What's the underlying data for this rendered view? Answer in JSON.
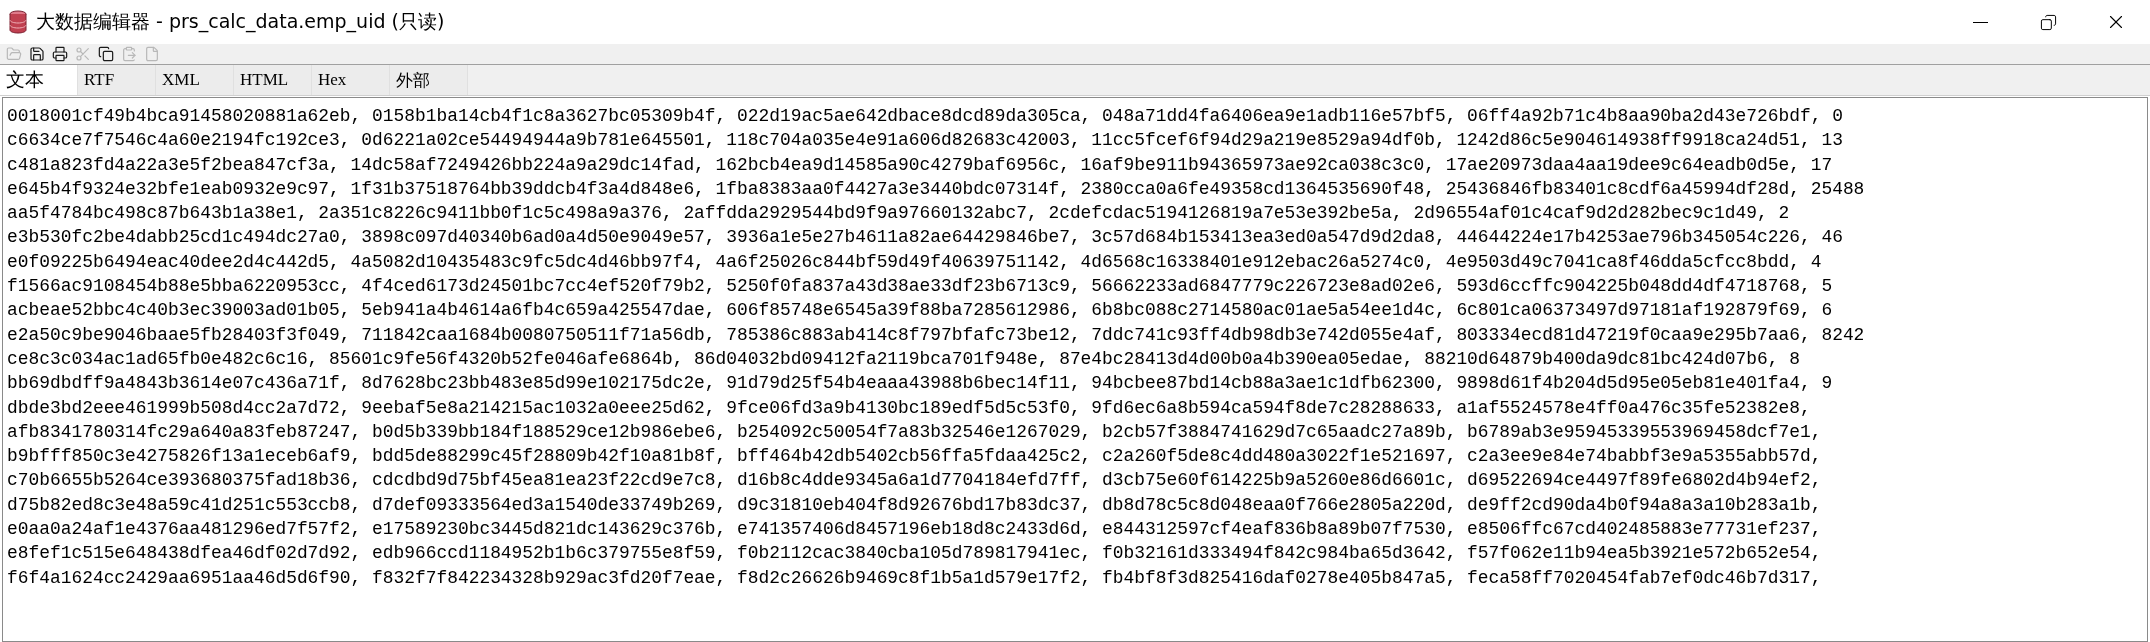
{
  "window": {
    "title": "大数据编辑器 - prs_calc_data.emp_uid (只读)"
  },
  "toolbar": [
    {
      "kind": "open",
      "disabled": true
    },
    {
      "kind": "save",
      "disabled": false
    },
    {
      "kind": "print",
      "disabled": false
    },
    {
      "kind": "cut",
      "disabled": true
    },
    {
      "kind": "copy",
      "disabled": false
    },
    {
      "kind": "paste",
      "disabled": true
    },
    {
      "kind": "page",
      "disabled": true
    }
  ],
  "tabs": [
    {
      "label": "文本",
      "selected": true
    },
    {
      "label": "RTF",
      "selected": false
    },
    {
      "label": "XML",
      "selected": false
    },
    {
      "label": "HTML",
      "selected": false
    },
    {
      "label": "Hex",
      "selected": false
    },
    {
      "label": "外部",
      "selected": false
    }
  ],
  "text_lines": [
    "0018001cf49b4bca91458020881a62eb, 0158b1ba14cb4f1c8a3627bc05309b4f, 022d19ac5ae642dbace8dcd89da305ca, 048a71dd4fa6406ea9e1adb116e57bf5, 06ff4a92b71c4b8aa90ba2d43e726bdf, 0",
    "c6634ce7f7546c4a60e2194fc192ce3, 0d6221a02ce54494944a9b781e645501, 118c704a035e4e91a606d82683c42003, 11cc5fcef6f94d29a219e8529a94df0b, 1242d86c5e904614938ff9918ca24d51, 13",
    "c481a823fd4a22a3e5f2bea847cf3a, 14dc58af7249426bb224a9a29dc14fad, 162bcb4ea9d14585a90c4279baf6956c, 16af9be911b94365973ae92ca038c3c0, 17ae20973daa4aa19dee9c64eadb0d5e, 17",
    "e645b4f9324e32bfe1eab0932e9c97, 1f31b37518764bb39ddcb4f3a4d848e6, 1fba8383aa0f4427a3e3440bdc07314f, 2380cca0a6fe49358cd1364535690f48, 25436846fb83401c8cdf6a45994df28d, 25488",
    "aa5f4784bc498c87b643b1a38e1, 2a351c8226c9411bb0f1c5c498a9a376, 2affdda2929544bd9f9a97660132abc7, 2cdefcdac5194126819a7e53e392be5a, 2d96554af01c4caf9d2d282bec9c1d49, 2",
    "e3b530fc2be4dabb25cd1c494dc27a0, 3898c097d40340b6ad0a4d50e9049e57, 3936a1e5e27b4611a82ae64429846be7, 3c57d684b153413ea3ed0a547d9d2da8, 44644224e17b4253ae796b345054c226, 46",
    "e0f09225b6494eac40dee2d4c442d5, 4a5082d10435483c9fc5dc4d46bb97f4, 4a6f25026c844bf59d49f40639751142, 4d6568c16338401e912ebac26a5274c0, 4e9503d49c7041ca8f46dda5cfcc8bdd, 4",
    "f1566ac9108454b88e5bba6220953cc, 4f4ced6173d24501bc7cc4ef520f79b2, 5250f0fa837a43d38ae33df23b6713c9, 56662233ad6847779c226723e8ad02e6, 593d6ccffc904225b048dd4df4718768, 5",
    "acbeae52bbc4c40b3ec39003ad01b05, 5eb941a4b4614a6fb4c659a425547dae, 606f85748e6545a39f88ba7285612986, 6b8bc088c2714580ac01ae5a54ee1d4c, 6c801ca06373497d97181af192879f69, 6",
    "e2a50c9be9046baae5fb28403f3f049, 711842caa1684b0080750511f71a56db, 785386c883ab414c8f797bfafc73be12, 7ddc741c93ff4db98db3e742d055e4af, 803334ecd81d47219f0caa9e295b7aa6, 8242",
    "ce8c3c034ac1ad65fb0e482c6c16, 85601c9fe56f4320b52fe046afe6864b, 86d04032bd09412fa2119bca701f948e, 87e4bc28413d4d00b0a4b390ea05edae, 88210d64879b400da9dc81bc424d07b6, 8",
    "bb69dbdff9a4843b3614e07c436a71f, 8d7628bc23bb483e85d99e102175dc2e, 91d79d25f54b4eaaa43988b6bec14f11, 94bcbee87bd14cb88a3ae1c1dfb62300, 9898d61f4b204d5d95e05eb81e401fa4, 9",
    "dbde3bd2eee461999b508d4cc2a7d72, 9eebaf5e8a214215ac1032a0eee25d62, 9fce06fd3a9b4130bc189edf5d5c53f0, 9fd6ec6a8b594ca594f8de7c28288633, a1af5524578e4ff0a476c35fe52382e8,",
    "afb8341780314fc29a640a83feb87247, b0d5b339bb184f188529ce12b986ebe6, b254092c50054f7a83b32546e1267029, b2cb57f3884741629d7c65aadc27a89b, b6789ab3e95945339553969458dcf7e1,",
    "b9bfff850c3e4275826f13a1eceb6af9, bdd5de88299c45f28809b42f10a81b8f, bff464b42db5402cb56ffa5fdaa425c2, c2a260f5de8c4dd480a3022f1e521697, c2a3ee9e84e74babbf3e9a5355abb57d,",
    "c70b6655b5264ce393680375fad18b36, cdcdbd9d75bf45ea81ea23f22cd9e7c8, d16b8c4dde9345a6a1d7704184efd7ff, d3cb75e60f614225b9a5260e86d6601c, d69522694ce4497f89fe6802d4b94ef2,",
    "d75b82ed8c3e48a59c41d251c553ccb8, d7def09333564ed3a1540de33749b269, d9c31810eb404f8d92676bd17b83dc37, db8d78c5c8d048eaa0f766e2805a220d, de9ff2cd90da4b0f94a8a3a10b283a1b,",
    "e0aa0a24af1e4376aa481296ed7f57f2, e17589230bc3445d821dc143629c376b, e741357406d8457196eb18d8c2433d6d, e844312597cf4eaf836b8a89b07f7530, e8506ffc67cd402485883e77731ef237,",
    "e8fef1c515e648438dfea46df02d7d92, edb966ccd1184952b1b6c379755e8f59, f0b2112cac3840cba105d789817941ec, f0b32161d333494f842c984ba65d3642, f57f062e11b94ea5b3921e572b652e54,",
    "f6f4a1624cc2429aa6951aa46d5d6f90, f832f7f842234328b929ac3fd20f7eae, f8d2c26626b9469c8f1b5a1d579e17f2, fb4bf8f3d825416daf0278e405b847a5, feca58ff7020454fab7ef0dc46b7d317,"
  ]
}
